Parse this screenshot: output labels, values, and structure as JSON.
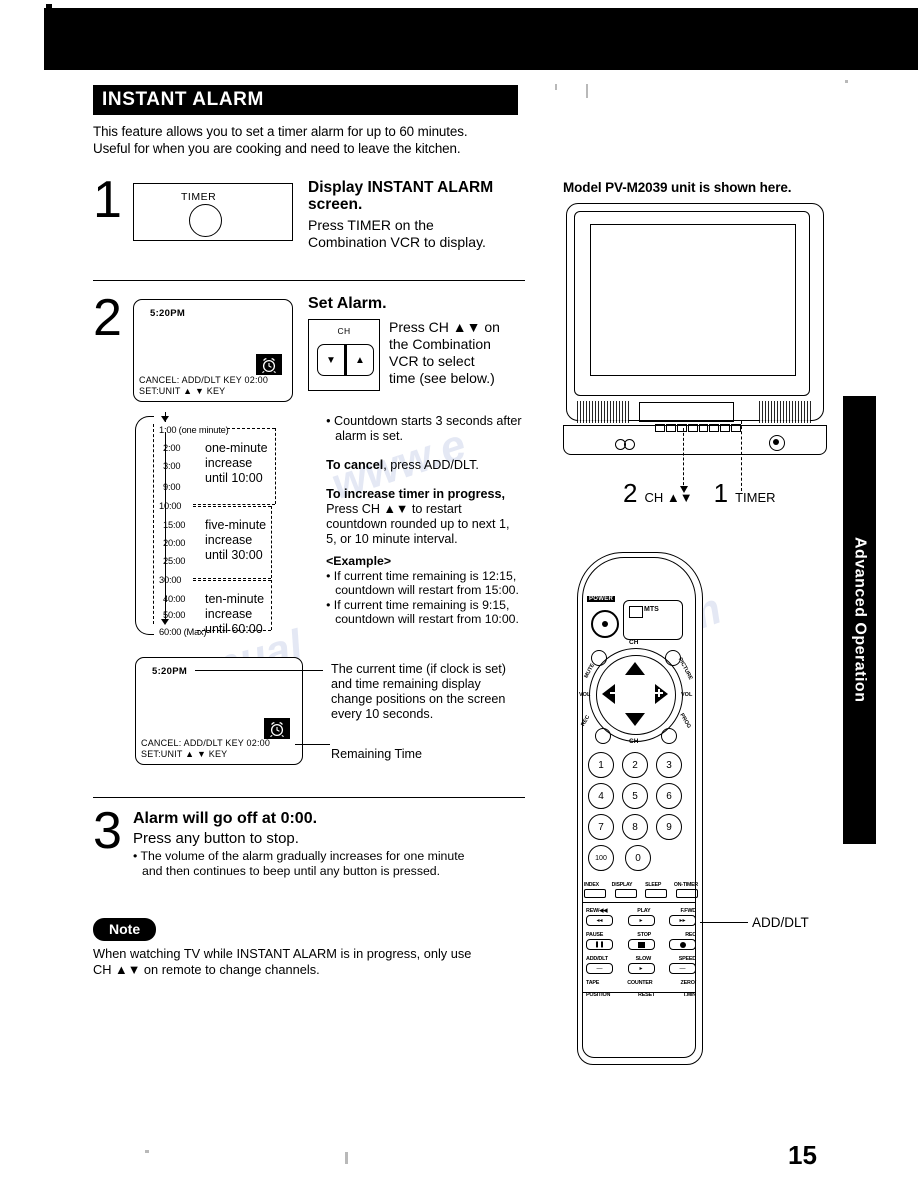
{
  "document": {
    "page_number": "15",
    "side_tab": "Advanced Operation"
  },
  "section": {
    "title": "INSTANT ALARM",
    "intro_line1": "This feature allows you to set a timer alarm for up to 60 minutes.",
    "intro_line2": "Useful for when you are cooking and need to leave the kitchen."
  },
  "steps": [
    {
      "number": "1",
      "heading_line1": "Display INSTANT ALARM",
      "heading_line2": "screen.",
      "body_line1": "Press TIMER on the",
      "body_line2": "Combination VCR to display.",
      "button_label": "TIMER"
    },
    {
      "number": "2",
      "heading": "Set Alarm.",
      "body_line1": "Press CH ▲▼ on",
      "body_line2": "the Combination",
      "body_line3": "VCR to select",
      "body_line4": "time (see below.)",
      "ch_label": "CH",
      "ch_down": "▼",
      "ch_up": "▲"
    },
    {
      "number": "3",
      "heading": "Alarm will go off at 0:00.",
      "body": "Press any button to stop.",
      "bullet_line1": "• The volume of the alarm gradually increases for one minute",
      "bullet_line2": "and then continues to beep until any button is pressed."
    }
  ],
  "osd_screen": {
    "clock": "5:20PM",
    "line1": "CANCEL: ADD/DLT  KEY  02:00",
    "line2": "SET:UNIT ▲ ▼ KEY",
    "alarm_icon": "alarm-clock-icon"
  },
  "interval_diagram": {
    "times": [
      "1:00 (one minute)",
      "2:00",
      "3:00",
      "9:00",
      "10:00",
      "15:00",
      "20:00",
      "25:00",
      "30:00",
      "40:00",
      "50:00",
      "60:00 (Max)"
    ],
    "groups": [
      {
        "l1": "one-minute",
        "l2": "increase",
        "l3": "until 10:00"
      },
      {
        "l1": "five-minute",
        "l2": "increase",
        "l3": "until 30:00"
      },
      {
        "l1": "ten-minute",
        "l2": "increase",
        "l3": "until 60:00"
      }
    ]
  },
  "notes_right_of_step2": {
    "bullet_line1": "• Countdown starts 3 seconds after",
    "bullet_line2": "alarm is set.",
    "cancel_bold": "To cancel",
    "cancel_rest": ", press ADD/DLT.",
    "increase_bold": "To increase timer in progress,",
    "increase_line1": "Press CH ▲▼ to restart",
    "increase_line2": "countdown rounded up to next 1,",
    "increase_line3": "5, or 10 minute interval.",
    "example_header": "<Example>",
    "example1_line1": "• If current time remaining is 12:15,",
    "example1_line2": "countdown will restart from 15:00.",
    "example2_line1": "• If current time remaining is 9:15,",
    "example2_line2": "countdown will restart from 10:00."
  },
  "osd_callouts": {
    "top_line1": "The current time (if clock is set)",
    "top_line2": "and time remaining display",
    "top_line3": "change positions on the screen",
    "top_line4": "every 10 seconds.",
    "bottom": "Remaining Time"
  },
  "note_block": {
    "badge": "Note",
    "line1": "When watching TV while INSTANT ALARM is in progress, only use",
    "line2": "CH ▲▼ on remote to change channels."
  },
  "tv_illustration": {
    "caption": "Model PV-M2039 unit is shown here.",
    "callout_ch_num": "2",
    "callout_ch_label": "CH ▲▼",
    "callout_timer_num": "1",
    "callout_timer_label": "TIMER"
  },
  "remote": {
    "power_label": "POWER",
    "panel_label": "MTS",
    "ch_label_top": "CH",
    "ch_label_bottom": "CH",
    "left_labels": [
      "MUTE",
      "VOL",
      "REC"
    ],
    "right_labels": [
      "PICTURE",
      "VOL",
      "PROG"
    ],
    "keypad": [
      [
        "1",
        "2",
        "3"
      ],
      [
        "4",
        "5",
        "6"
      ],
      [
        "7",
        "8",
        "9"
      ],
      [
        "100",
        "0"
      ]
    ],
    "function_row": [
      "INDEX",
      "DISPLAY",
      "SLEEP",
      "ON-TIMER"
    ],
    "vcr_rows": [
      [
        "REW/◀◀",
        "PLAY",
        "F.FWD"
      ],
      [
        "PAUSE",
        "STOP",
        "REC"
      ],
      [
        "ADD/DLT",
        "SLOW",
        "SPEED"
      ],
      [
        "TAPE",
        "COUNTER",
        "ZERO/"
      ],
      [
        "POSITION",
        "RESET",
        "T.MIN"
      ]
    ],
    "callout_add_dlt": "ADD/DLT"
  }
}
